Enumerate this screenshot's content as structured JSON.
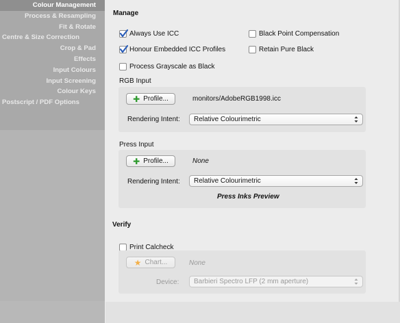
{
  "sidebar": {
    "items": [
      {
        "label": "Colour Management"
      },
      {
        "label": "Process & Resampling"
      },
      {
        "label": "Fit & Rotate"
      },
      {
        "label": "Centre & Size Correction"
      },
      {
        "label": "Crop & Pad"
      },
      {
        "label": "Effects"
      },
      {
        "label": "Input Colours"
      },
      {
        "label": "Input Screening"
      },
      {
        "label": "Colour Keys"
      },
      {
        "label": "Postscript / PDF Options"
      }
    ]
  },
  "manage": {
    "title": "Manage",
    "always_use_icc": {
      "label": "Always Use ICC",
      "checked": true
    },
    "black_point": {
      "label": "Black Point Compensation",
      "checked": false
    },
    "honour_embedded": {
      "label": "Honour Embedded ICC Profiles",
      "checked": true
    },
    "retain_black": {
      "label": "Retain Pure Black",
      "checked": false
    },
    "grayscale_black": {
      "label": "Process Grayscale as Black",
      "checked": false
    }
  },
  "rgb_input": {
    "title": "RGB Input",
    "profile_button": "Profile...",
    "profile_value": "monitors/AdobeRGB1998.icc",
    "rendering_label": "Rendering Intent:",
    "rendering_value": "Relative Colourimetric"
  },
  "press_input": {
    "title": "Press Input",
    "profile_button": "Profile...",
    "profile_value": "None",
    "rendering_label": "Rendering Intent:",
    "rendering_value": "Relative Colourimetric",
    "preview_label": "Press Inks Preview"
  },
  "verify": {
    "title": "Verify",
    "calcheck": {
      "label": "Print Calcheck",
      "checked": false
    },
    "chart_button": "Chart...",
    "chart_value": "None",
    "device_label": "Device:",
    "device_value": "Barbieri Spectro LFP (2 mm aperture)"
  },
  "colors": {
    "add_icon": "#2e9a2e",
    "star_icon": "#f3b04a",
    "check": "#2a5db8"
  },
  "icons": {
    "add": "plus-icon",
    "star": "star-icon",
    "select_arrows": "updown-arrows-icon",
    "checkmark": "checkmark-icon"
  }
}
